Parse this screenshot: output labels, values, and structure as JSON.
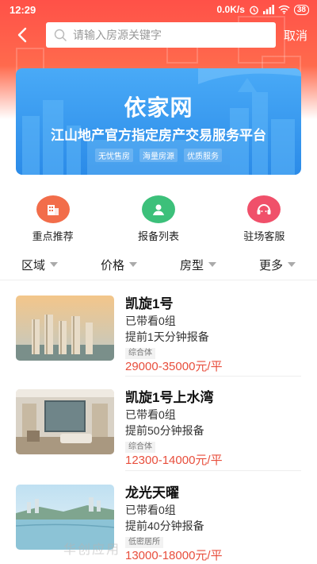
{
  "status_bar": {
    "time": "12:29",
    "speed": "0.0K/s",
    "battery": "38"
  },
  "search": {
    "placeholder": "请输入房源关键字",
    "value": "",
    "cancel_label": "取消"
  },
  "banner": {
    "title": "依家网",
    "subtitle": "江山地产官方指定房产交易服务平台",
    "tags": [
      "无忧售房",
      "海量房源",
      "优质服务"
    ]
  },
  "quick_nav": [
    {
      "label": "重点推荐",
      "icon": "building-icon",
      "color": "#f26d4a"
    },
    {
      "label": "报备列表",
      "icon": "user-report-icon",
      "color": "#3cc07a"
    },
    {
      "label": "驻场客服",
      "icon": "customer-service-icon",
      "color": "#f0506a"
    }
  ],
  "filters": [
    "区域",
    "价格",
    "房型",
    "更多"
  ],
  "listings": [
    {
      "name": "凯旋1号",
      "viewed": "已带看0组",
      "report": "提前1天分钟报备",
      "tag": "综合体",
      "price": "29000-35000元/平"
    },
    {
      "name": "凯旋1号上水湾",
      "viewed": "已带看0组",
      "report": "提前50分钟报备",
      "tag": "综合体",
      "price": "12300-14000元/平"
    },
    {
      "name": "龙光天曜",
      "viewed": "已带看0组",
      "report": "提前40分钟报备",
      "tag": "低密居所",
      "price": "13000-18000元/平"
    }
  ],
  "watermark": "华创应用"
}
